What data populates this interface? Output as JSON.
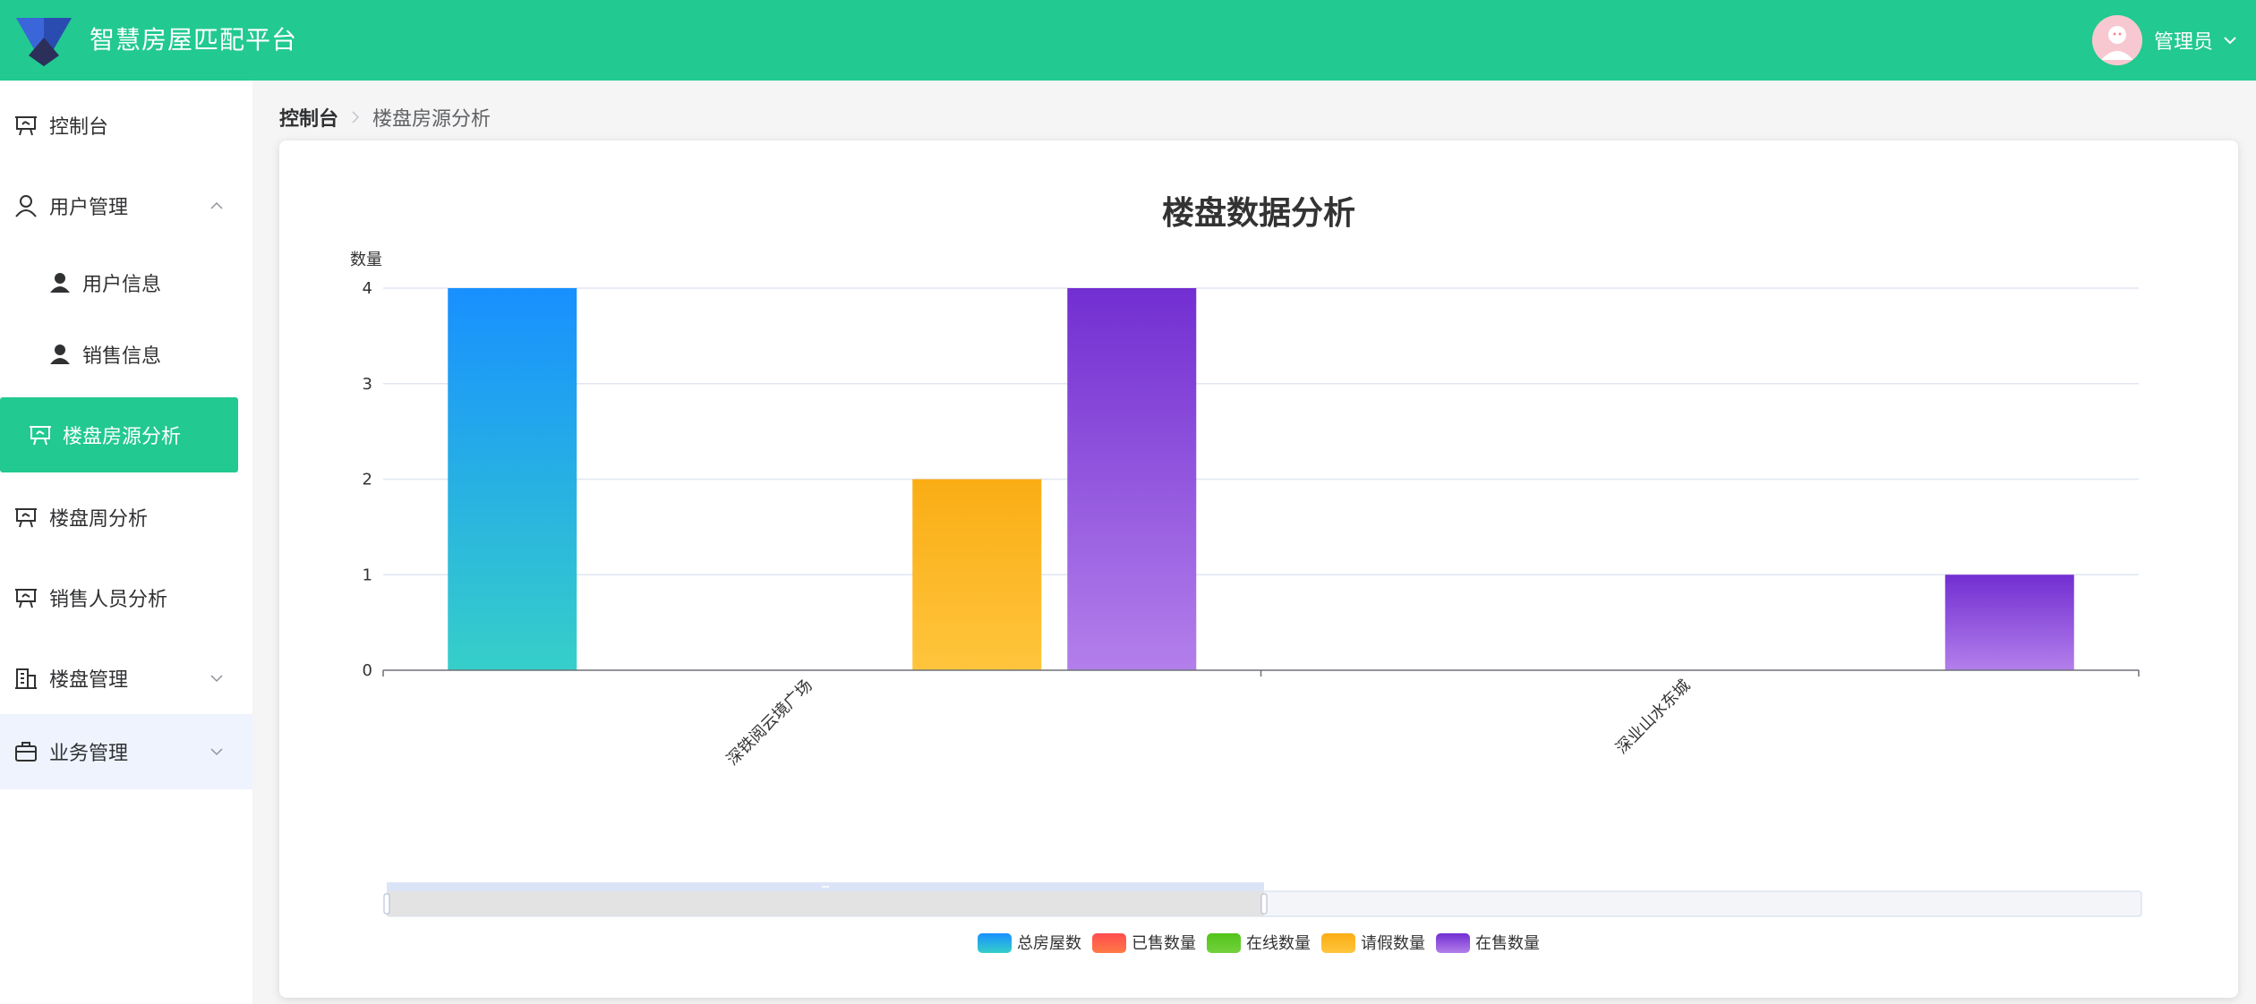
{
  "app": {
    "title": "智慧房屋匹配平台"
  },
  "user": {
    "name": "管理员"
  },
  "sidebar": {
    "items": [
      {
        "label": "控制台",
        "icon": "presentation-icon"
      },
      {
        "label": "用户管理",
        "icon": "user-outline-icon",
        "expanded": true
      },
      {
        "label": "用户信息",
        "icon": "user-filled-icon"
      },
      {
        "label": "销售信息",
        "icon": "user-filled-icon"
      },
      {
        "label": "楼盘房源分析",
        "icon": "presentation-icon",
        "active": true
      },
      {
        "label": "楼盘周分析",
        "icon": "presentation-icon"
      },
      {
        "label": "销售人员分析",
        "icon": "presentation-icon"
      },
      {
        "label": "楼盘管理",
        "icon": "building-icon",
        "expanded": false
      },
      {
        "label": "业务管理",
        "icon": "briefcase-icon",
        "expanded": false
      }
    ]
  },
  "breadcrumb": {
    "home": "控制台",
    "current": "楼盘房源分析"
  },
  "colors": {
    "brand": "#22c990",
    "total": [
      "#1890ff",
      "#36cfc9"
    ],
    "sold": [
      "#ff4d4f",
      "#ff7a45"
    ],
    "online": [
      "#52c41a",
      "#73d13d"
    ],
    "leave": [
      "#faad14",
      "#ffc53d"
    ],
    "onsale": [
      "#722ed1",
      "#b37feb"
    ]
  },
  "chart_data": {
    "type": "bar",
    "title": "楼盘数据分析",
    "ylabel": "数量",
    "ylim": [
      0,
      4
    ],
    "yticks": [
      0,
      1,
      2,
      3,
      4
    ],
    "categories": [
      "深铁阅云境广场",
      "深业山水东城"
    ],
    "series": [
      {
        "name": "总房屋数",
        "values": [
          4,
          0
        ],
        "color_key": "total"
      },
      {
        "name": "已售数量",
        "values": [
          0,
          0
        ],
        "color_key": "sold"
      },
      {
        "name": "在线数量",
        "values": [
          0,
          0
        ],
        "color_key": "online"
      },
      {
        "name": "请假数量",
        "values": [
          2,
          0
        ],
        "color_key": "leave"
      },
      {
        "name": "在售数量",
        "values": [
          4,
          1
        ],
        "color_key": "onsale"
      }
    ],
    "legend_position": "bottom",
    "grid": true,
    "datazoom": {
      "start": 0,
      "end": 50
    }
  }
}
